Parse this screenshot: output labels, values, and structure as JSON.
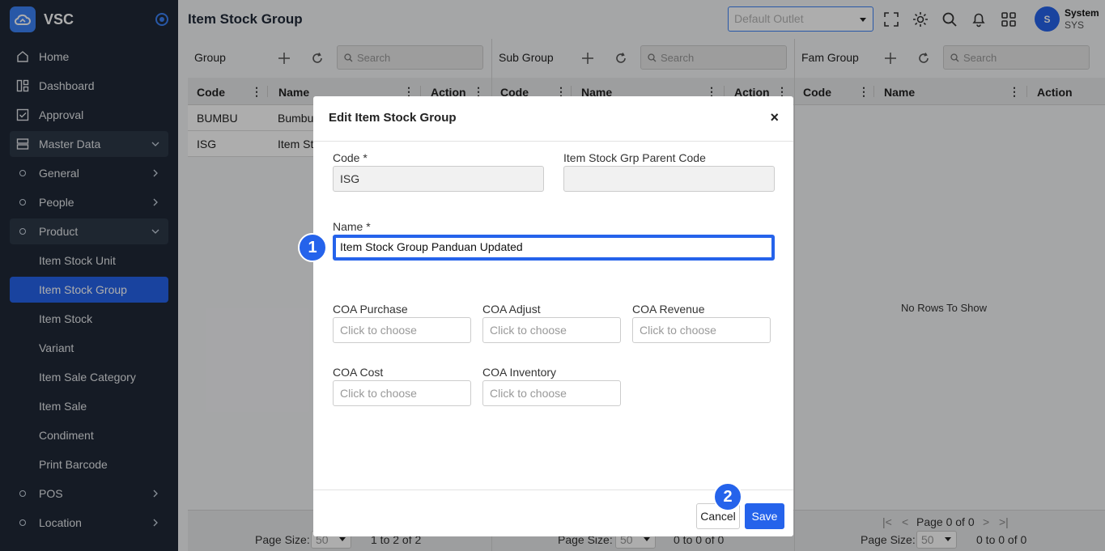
{
  "app": {
    "name": "VSC"
  },
  "sidebar": {
    "items": [
      {
        "label": "Home"
      },
      {
        "label": "Dashboard"
      },
      {
        "label": "Approval"
      },
      {
        "label": "Master Data"
      },
      {
        "label": "General"
      },
      {
        "label": "People"
      },
      {
        "label": "Product"
      },
      {
        "label": "Item Stock Unit"
      },
      {
        "label": "Item Stock Group"
      },
      {
        "label": "Item Stock"
      },
      {
        "label": "Variant"
      },
      {
        "label": "Item Sale Category"
      },
      {
        "label": "Item Sale"
      },
      {
        "label": "Condiment"
      },
      {
        "label": "Print Barcode"
      },
      {
        "label": "POS"
      },
      {
        "label": "Location"
      }
    ]
  },
  "header": {
    "title": "Item Stock Group",
    "outlet_placeholder": "Default Outlet",
    "user": {
      "initial": "S",
      "name": "System",
      "code": "SYS"
    }
  },
  "panels": {
    "group": {
      "title": "Group",
      "search_placeholder": "Search",
      "columns": {
        "code": "Code",
        "name": "Name",
        "action": "Action"
      },
      "rows": [
        {
          "code": "BUMBU",
          "name": "Bumbu"
        },
        {
          "code": "ISG",
          "name": "Item St"
        }
      ],
      "page_size_label": "Page Size:",
      "page_size": "50",
      "range": "1 to 2 of 2"
    },
    "subgroup": {
      "title": "Sub Group",
      "search_placeholder": "Search",
      "columns": {
        "code": "Code",
        "name": "Name",
        "action": "Action"
      },
      "page_size_label": "Page Size:",
      "page_size": "50",
      "range": "0 to 0 of 0"
    },
    "famgroup": {
      "title": "Fam Group",
      "search_placeholder": "Search",
      "columns": {
        "code": "Code",
        "name": "Name",
        "action": "Action"
      },
      "empty": "No Rows To Show",
      "page_label": "Page 0 of 0",
      "page_size_label": "Page Size:",
      "page_size": "50",
      "range": "0 to 0 of 0"
    }
  },
  "modal": {
    "title": "Edit Item Stock Group",
    "close": "×",
    "fields": {
      "code_label": "Code *",
      "code_value": "ISG",
      "parent_label": "Item Stock Grp Parent Code",
      "parent_value": "",
      "name_label": "Name *",
      "name_value": "Item Stock Group Panduan Updated",
      "coa_purchase_label": "COA Purchase",
      "coa_adjust_label": "COA Adjust",
      "coa_revenue_label": "COA Revenue",
      "coa_cost_label": "COA Cost",
      "coa_inventory_label": "COA Inventory",
      "choose_placeholder": "Click to choose"
    },
    "cancel_label": "Cancel",
    "save_label": "Save"
  },
  "annotations": {
    "step1": "1",
    "step2": "2"
  },
  "colors": {
    "accent": "#2563eb",
    "sidebar_bg": "#1f2937"
  }
}
